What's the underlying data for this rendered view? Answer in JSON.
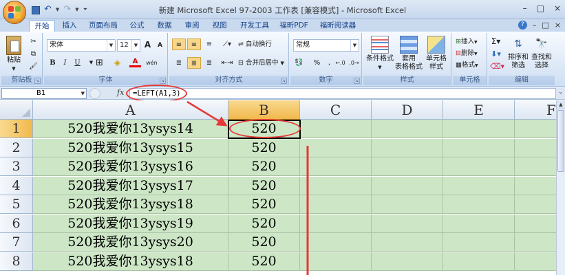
{
  "window": {
    "title": "新建 Microsoft Excel 97-2003 工作表 [兼容模式] - Microsoft Excel",
    "controls": [
      "–",
      "□",
      "×"
    ]
  },
  "quick_access": [
    "save-icon",
    "undo-icon",
    "redo-icon",
    "customize-icon"
  ],
  "tabs": [
    "开始",
    "插入",
    "页面布局",
    "公式",
    "数据",
    "审阅",
    "视图",
    "开发工具",
    "福昕PDF",
    "福昕阅读器"
  ],
  "active_tab": "开始",
  "ribbon": {
    "clipboard": {
      "label": "剪贴板",
      "paste": "粘贴"
    },
    "font": {
      "label": "字体",
      "name": "宋体",
      "size": "12",
      "bold": "B",
      "italic": "I",
      "underline": "U",
      "grow": "A",
      "shrink": "A",
      "color_a": "A",
      "wen": "wén"
    },
    "alignment": {
      "label": "对齐方式",
      "wrap": "自动换行",
      "merge": "合并后居中"
    },
    "number": {
      "label": "数字",
      "format": "常规",
      "percent": "%",
      "comma": ","
    },
    "styles": {
      "label": "样式",
      "conditional": "条件格式",
      "table1": "套用",
      "table2": "表格格式",
      "cell1": "单元格",
      "cell2": "样式"
    },
    "cells": {
      "label": "单元格",
      "insert": "插入",
      "delete": "删除",
      "format": "格式"
    },
    "editing": {
      "label": "编辑",
      "sort1": "排序和",
      "sort2": "筛选",
      "find1": "查找和",
      "find2": "选择"
    }
  },
  "formula_bar": {
    "name_box": "B1",
    "fx": "fx",
    "formula": "=LEFT(A1,3)"
  },
  "columns": [
    "A",
    "B",
    "C",
    "D",
    "E",
    "F"
  ],
  "rows": [
    {
      "num": "1",
      "a": "520我爱你13ysys14",
      "b": "520"
    },
    {
      "num": "2",
      "a": "520我爱你13ysys15",
      "b": "520"
    },
    {
      "num": "3",
      "a": "520我爱你13ysys16",
      "b": "520"
    },
    {
      "num": "4",
      "a": "520我爱你13ysys17",
      "b": "520"
    },
    {
      "num": "5",
      "a": "520我爱你13ysys18",
      "b": "520"
    },
    {
      "num": "6",
      "a": "520我爱你13ysys19",
      "b": "520"
    },
    {
      "num": "7",
      "a": "520我爱你13ysys20",
      "b": "520"
    },
    {
      "num": "8",
      "a": "520我爱你13ysys18",
      "b": "520"
    }
  ],
  "selected_cell": "B1",
  "colors": {
    "cell_fill": "#cde6c6",
    "annotation": "#e53935",
    "header_selected": "#f1b94d"
  }
}
